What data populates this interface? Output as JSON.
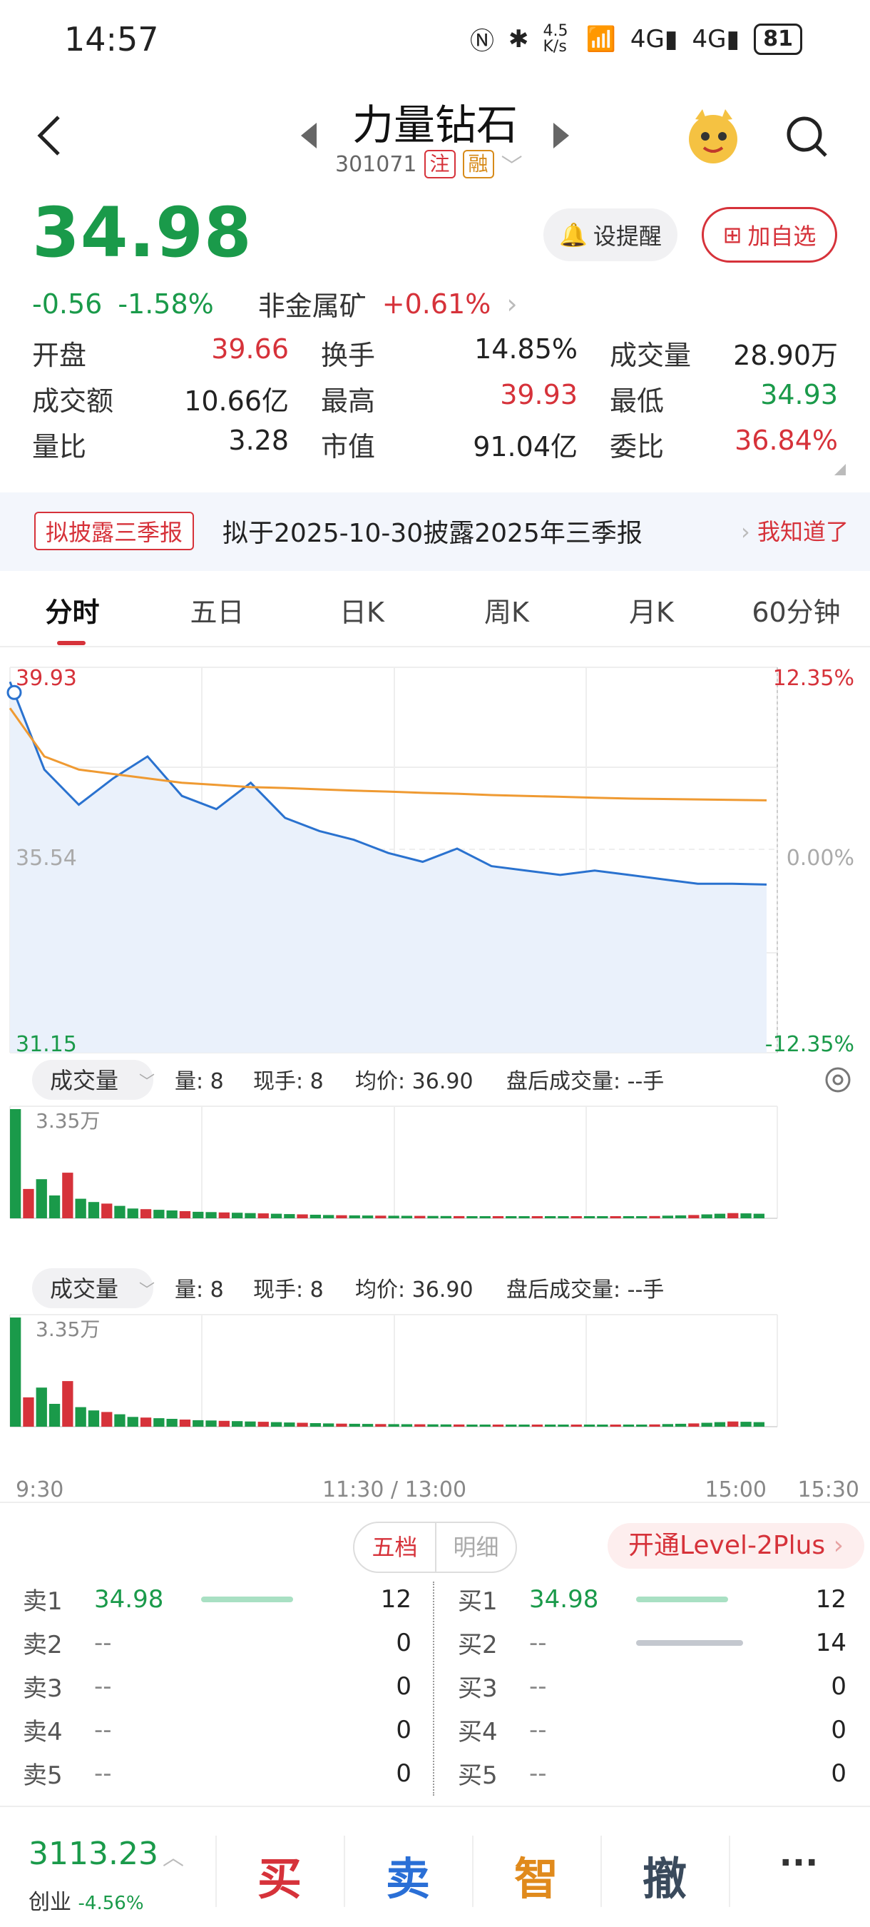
{
  "status_bar": {
    "time": "14:57",
    "net_speed": "4.5 K/s",
    "battery": "81"
  },
  "header": {
    "stock_name": "力量钻石",
    "stock_code": "301071",
    "tag_zhu": "注",
    "tag_rong": "融"
  },
  "quote": {
    "price": "34.98",
    "change": "-0.56",
    "change_pct": "-1.58%",
    "sector": "非金属矿",
    "sector_change": "+0.61%",
    "alert_label": "设提醒",
    "fav_label": "加自选"
  },
  "stats": [
    [
      {
        "label": "开盘",
        "value": "39.66",
        "color": "red"
      },
      {
        "label": "换手",
        "value": "14.85%",
        "color": "black"
      },
      {
        "label": "成交量",
        "value": "28.90万",
        "color": "black"
      }
    ],
    [
      {
        "label": "成交额",
        "value": "10.66亿",
        "color": "black"
      },
      {
        "label": "最高",
        "value": "39.93",
        "color": "red"
      },
      {
        "label": "最低",
        "value": "34.93",
        "color": "green"
      }
    ],
    [
      {
        "label": "量比",
        "value": "3.28",
        "color": "black"
      },
      {
        "label": "市值",
        "value": "91.04亿",
        "color": "black"
      },
      {
        "label": "委比",
        "value": "36.84%",
        "color": "red"
      }
    ]
  ],
  "banner": {
    "badge": "拟披露三季报",
    "message": "拟于2025-10-30披露2025年三季报",
    "dismiss": "我知道了"
  },
  "tabs": [
    "分时",
    "五日",
    "日K",
    "周K",
    "月K",
    "60分钟"
  ],
  "chart_data": {
    "type": "line",
    "y_left_ticks": [
      "39.93",
      "35.54",
      "31.15"
    ],
    "y_right_ticks": [
      "12.35%",
      "0.00%",
      "-12.35%"
    ],
    "x_ticks": [
      "9:30",
      "11:30 / 13:00",
      "15:00",
      "15:30"
    ],
    "ylim": [
      31.15,
      39.93
    ],
    "prev_close": 35.54,
    "series": [
      {
        "values": [
          39.6,
          37.6,
          36.8,
          37.4,
          37.9,
          37.0,
          36.7,
          37.3,
          36.5,
          36.2,
          36.0,
          35.7,
          35.5,
          35.8,
          35.4,
          35.3,
          35.2,
          35.3,
          35.2,
          35.1,
          35.0,
          35.0,
          34.98
        ]
      },
      {
        "values": [
          39.0,
          37.9,
          37.6,
          37.5,
          37.4,
          37.3,
          37.25,
          37.2,
          37.18,
          37.15,
          37.12,
          37.1,
          37.07,
          37.05,
          37.02,
          37.0,
          36.98,
          36.96,
          36.94,
          36.93,
          36.92,
          36.91,
          36.9
        ]
      }
    ]
  },
  "volume_panel": {
    "selector": "成交量",
    "vol": "量: 8",
    "current": "现手: 8",
    "avg": "均价: 36.90",
    "after_hours": "盘后成交量: --手",
    "max_label": "3.35万",
    "volumes": [
      33500,
      9000,
      12000,
      7000,
      14000,
      6000,
      5000,
      4500,
      3800,
      3000,
      2800,
      2600,
      2400,
      2200,
      2000,
      1900,
      1800,
      1700,
      1600,
      1500,
      1400,
      1300,
      1200,
      1100,
      1000,
      950,
      900,
      850,
      800,
      780,
      760,
      740,
      720,
      700,
      680,
      660,
      640,
      620,
      600,
      580,
      560,
      540,
      520,
      500,
      520,
      540,
      560,
      600,
      640,
      700,
      800,
      900,
      1000,
      1200,
      1400,
      1600,
      1500,
      1400
    ]
  },
  "order_book": {
    "tab_on": "五档",
    "tab_off": "明细",
    "level2": "开通Level-2Plus",
    "sells": [
      {
        "label": "卖1",
        "price": "34.98",
        "qty": "12"
      },
      {
        "label": "卖2",
        "price": "--",
        "qty": "0"
      },
      {
        "label": "卖3",
        "price": "--",
        "qty": "0"
      },
      {
        "label": "卖4",
        "price": "--",
        "qty": "0"
      },
      {
        "label": "卖5",
        "price": "--",
        "qty": "0"
      }
    ],
    "buys": [
      {
        "label": "买1",
        "price": "34.98",
        "qty": "12"
      },
      {
        "label": "买2",
        "price": "--",
        "qty": "14"
      },
      {
        "label": "买3",
        "price": "--",
        "qty": "0"
      },
      {
        "label": "买4",
        "price": "--",
        "qty": "0"
      },
      {
        "label": "买5",
        "price": "--",
        "qty": "0"
      }
    ]
  },
  "bottom_bar": {
    "index_value": "3113.23",
    "index_name": "创业",
    "index_change": "-4.56%",
    "buy": "买",
    "sell": "卖",
    "smart": "智",
    "cancel": "撤",
    "more": "···"
  }
}
